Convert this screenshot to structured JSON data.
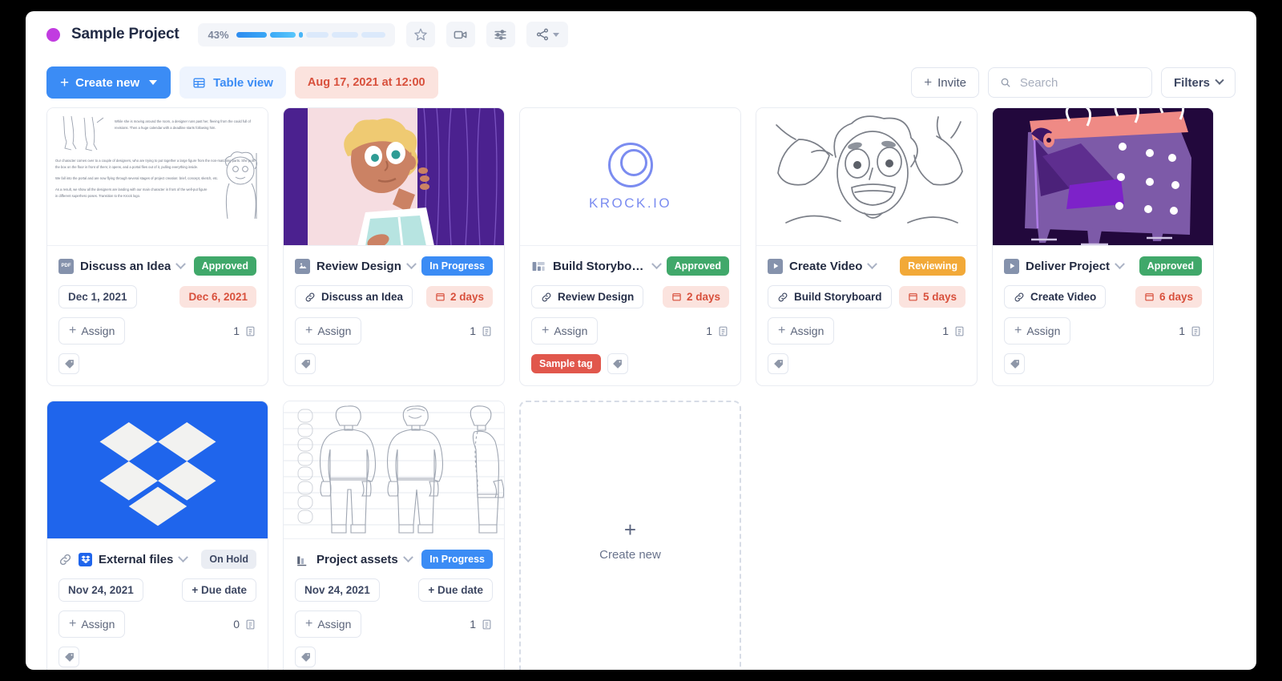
{
  "header": {
    "project_dot_color": "#c13ce0",
    "project_title": "Sample Project",
    "progress_percent": "43%",
    "progress_value": 43,
    "favorite_icon": "star-icon",
    "video_icon": "video-camera-icon",
    "settings_icon": "sliders-icon",
    "share_icon": "share-icon"
  },
  "toolbar": {
    "create_new_label": "Create new",
    "table_view_label": "Table view",
    "date_chip_label": "Aug 17, 2021 at 12:00",
    "invite_label": "Invite",
    "search_placeholder": "Search",
    "search_value": "",
    "filters_label": "Filters"
  },
  "board": {
    "placeholder": {
      "label": "Create new",
      "icon": "plus-icon"
    },
    "cards": [
      {
        "title": "Discuss an Idea",
        "file_icon": "pdf-file-icon",
        "thumb": "document-storyboard-text",
        "status": {
          "label": "Approved",
          "color": "#40a86a"
        },
        "left_pill": {
          "type": "date",
          "label": "Dec 1, 2021"
        },
        "right_pill": {
          "type": "date-danger",
          "label": "Dec 6, 2021"
        },
        "assign_label": "Assign",
        "task_count": "1",
        "tags": []
      },
      {
        "title": "Review Design",
        "file_icon": "image-file-icon",
        "thumb": "illustration-girl-curtain",
        "status": {
          "label": "In Progress",
          "color": "#3b8cf5"
        },
        "left_pill": {
          "type": "link",
          "label": "Discuss an Idea"
        },
        "right_pill": {
          "type": "duration",
          "label": "2 days"
        },
        "assign_label": "Assign",
        "task_count": "1",
        "tags": []
      },
      {
        "title": "Build Storyboa...",
        "file_icon": "presentation-file-icon",
        "thumb": "krock-logo",
        "status": {
          "label": "Approved",
          "color": "#40a86a"
        },
        "left_pill": {
          "type": "link",
          "label": "Review Design"
        },
        "right_pill": {
          "type": "duration",
          "label": "2 days"
        },
        "assign_label": "Assign",
        "task_count": "1",
        "tags": [
          {
            "label": "Sample tag",
            "color": "#e1574c"
          }
        ]
      },
      {
        "title": "Create Video",
        "file_icon": "video-file-icon",
        "thumb": "sketch-shocked-face",
        "status": {
          "label": "Reviewing",
          "color": "#f2a938"
        },
        "left_pill": {
          "type": "link",
          "label": "Build Storyboard"
        },
        "right_pill": {
          "type": "duration",
          "label": "5 days"
        },
        "assign_label": "Assign",
        "task_count": "1",
        "tags": []
      },
      {
        "title": "Deliver Project",
        "file_icon": "video-file-icon",
        "thumb": "illustration-purple-calendar-monster",
        "status": {
          "label": "Approved",
          "color": "#40a86a"
        },
        "left_pill": {
          "type": "link",
          "label": "Create Video"
        },
        "right_pill": {
          "type": "duration",
          "label": "6 days"
        },
        "assign_label": "Assign",
        "task_count": "1",
        "tags": []
      },
      {
        "title": "External files",
        "file_icon": "link-icon",
        "extra_icon": "dropbox-icon",
        "thumb": "dropbox-logo",
        "status": {
          "label": "On Hold",
          "color": "#eaedf3",
          "text_color": "#3d4762"
        },
        "left_pill": {
          "type": "date",
          "label": "Nov 24, 2021"
        },
        "right_pill": {
          "type": "add-due-date",
          "label": "+ Due date"
        },
        "assign_label": "Assign",
        "task_count": "0",
        "tags": []
      },
      {
        "title": "Project assets",
        "file_icon": "chart-file-icon",
        "thumb": "sketch-character-turnaround",
        "status": {
          "label": "In Progress",
          "color": "#3b8cf5"
        },
        "left_pill": {
          "type": "date",
          "label": "Nov 24, 2021"
        },
        "right_pill": {
          "type": "add-due-date",
          "label": "+ Due date"
        },
        "assign_label": "Assign",
        "task_count": "1",
        "tags": []
      }
    ]
  },
  "document_thumb_text": {
    "para1": "While she is moving around the room, a designer runs past her, fleeing from the could full of revisions. Then a huge calendar with a deadline starts following him.",
    "para2": "Our character comes over to a couple of designers, who are trying to put together a large figure from the non-matching parts. She puts the box on the floor in front of them; it opens, and a portal flies out of it, pulling everything inside.",
    "para3": "We fall into the portal and are now flying through several stages of project creation: brief, concept, sketch, etc.",
    "para4": "As a result, we show all the designers are landing with our main character in front of the well-put figure in different superhero poses. Transition to the Krock logo."
  },
  "krock_logo_text": "KROCK.IO"
}
